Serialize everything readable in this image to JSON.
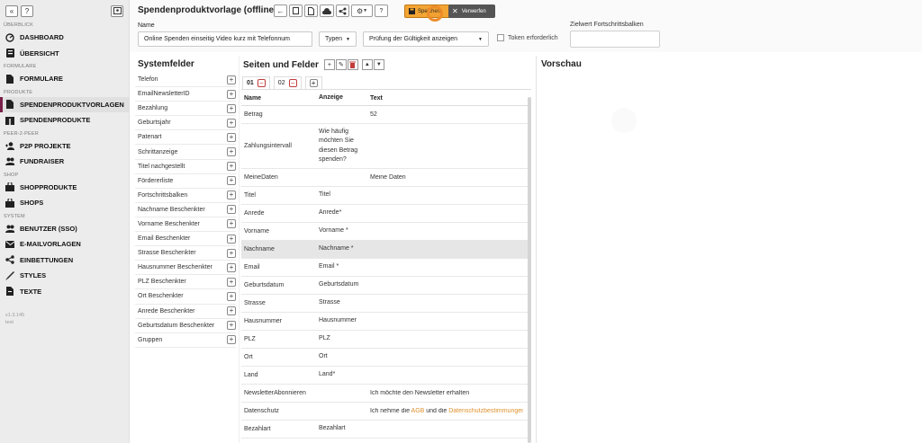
{
  "sidebar": {
    "sections": {
      "ueberblick": "ÜBERBLICK",
      "formulare": "FORMULARE",
      "produkte": "PRODUKTE",
      "p2p": "PEER-2-PEER",
      "shop": "SHOP",
      "system": "SYSTEM"
    },
    "items": [
      {
        "label": "DASHBOARD",
        "icon": "dashboard-icon"
      },
      {
        "label": "ÜBERSICHT",
        "icon": "overview-icon"
      },
      {
        "label": "FORMULARE",
        "icon": "document-icon"
      },
      {
        "label": "SPENDENPRODUKTVORLAGEN",
        "icon": "document-icon"
      },
      {
        "label": "SPENDENPRODUKTE",
        "icon": "gift-icon"
      },
      {
        "label": "P2P PROJEKTE",
        "icon": "users-plus-icon"
      },
      {
        "label": "FUNDRAISER",
        "icon": "users-icon"
      },
      {
        "label": "SHOPPRODUKTE",
        "icon": "bag-icon"
      },
      {
        "label": "SHOPS",
        "icon": "bag-icon"
      },
      {
        "label": "BENUTZER (SSO)",
        "icon": "users-icon"
      },
      {
        "label": "E-MAILVORLAGEN",
        "icon": "mail-icon"
      },
      {
        "label": "EINBETTUNGEN",
        "icon": "share-icon"
      },
      {
        "label": "STYLES",
        "icon": "brush-icon"
      },
      {
        "label": "TEXTE",
        "icon": "text-icon"
      }
    ],
    "version": "v1.3.145",
    "env": "test"
  },
  "header": {
    "title": "Spendenproduktvorlage (offline)",
    "save_label": "Speichern",
    "discard_label": "Verwerfen",
    "name_label": "Name",
    "name_value": "Online Spenden einseitig Video kurz mit Telefonnum",
    "typen_label": "Typen",
    "pruefung_label": "Prüfung der Gültigkeit anzeigen",
    "token_label": "Token erforderlich",
    "zielwert_label": "Zielwert Fortschrittsbalken",
    "accent_color": "#f3a533"
  },
  "systemfelder": {
    "title": "Systemfelder",
    "items": [
      "Telefon",
      "EmailNewsletterID",
      "Bezahlung",
      "Geburtsjahr",
      "Patenart",
      "Schrittanzeige",
      "Titel nachgestellt",
      "Fördererliste",
      "Fortschrittsbalken",
      "Nachname Beschenkter",
      "Vorname Beschenkter",
      "Email Beschenkter",
      "Strasse Beschenkter",
      "Hausnummer Beschenkter",
      "PLZ Beschenkter",
      "Ort Beschenkter",
      "Anrede Beschenkter",
      "Geburtsdatum Beschenkter",
      "Gruppen"
    ]
  },
  "seiten": {
    "title": "Seiten und Felder",
    "tabs": [
      "01",
      "02"
    ],
    "columns": [
      "Name",
      "Anzeige",
      "Text"
    ],
    "rows": [
      {
        "name": "Betrag",
        "anzeige": "",
        "text": "52"
      },
      {
        "name": "Zahlungsintervall",
        "anzeige": "Wie häufig möchten Sie diesen Betrag spenden?",
        "text": ""
      },
      {
        "name": "MeineDaten",
        "anzeige": "",
        "text": "Meine Daten"
      },
      {
        "name": "Titel",
        "anzeige": "Titel",
        "text": ""
      },
      {
        "name": "Anrede",
        "anzeige": "Anrede*",
        "text": ""
      },
      {
        "name": "Vorname",
        "anzeige": "Vorname *",
        "text": ""
      },
      {
        "name": "Nachname",
        "anzeige": "Nachname *",
        "text": ""
      },
      {
        "name": "Email",
        "anzeige": "Email *",
        "text": ""
      },
      {
        "name": "Geburtsdatum",
        "anzeige": "Geburtsdatum",
        "text": ""
      },
      {
        "name": "Strasse",
        "anzeige": "Strasse",
        "text": ""
      },
      {
        "name": "Hausnummer",
        "anzeige": "Hausnummer",
        "text": ""
      },
      {
        "name": "PLZ",
        "anzeige": "PLZ",
        "text": ""
      },
      {
        "name": "Ort",
        "anzeige": "Ort",
        "text": ""
      },
      {
        "name": "Land",
        "anzeige": "Land*",
        "text": ""
      },
      {
        "name": "NewsletterAbonnieren",
        "anzeige": "",
        "text": "Ich möchte den Newsletter erhalten"
      },
      {
        "name": "Datenschutz",
        "anzeige": "",
        "text": ""
      },
      {
        "name": "Bezahlart",
        "anzeige": "Bezahlart",
        "text": ""
      }
    ],
    "datenschutz_text": {
      "pre": "Ich nehme die ",
      "agb": "AGB",
      "mid": " und die ",
      "ds": "Datenschutzbestimmungen"
    }
  },
  "vorschau": {
    "title": "Vorschau"
  }
}
